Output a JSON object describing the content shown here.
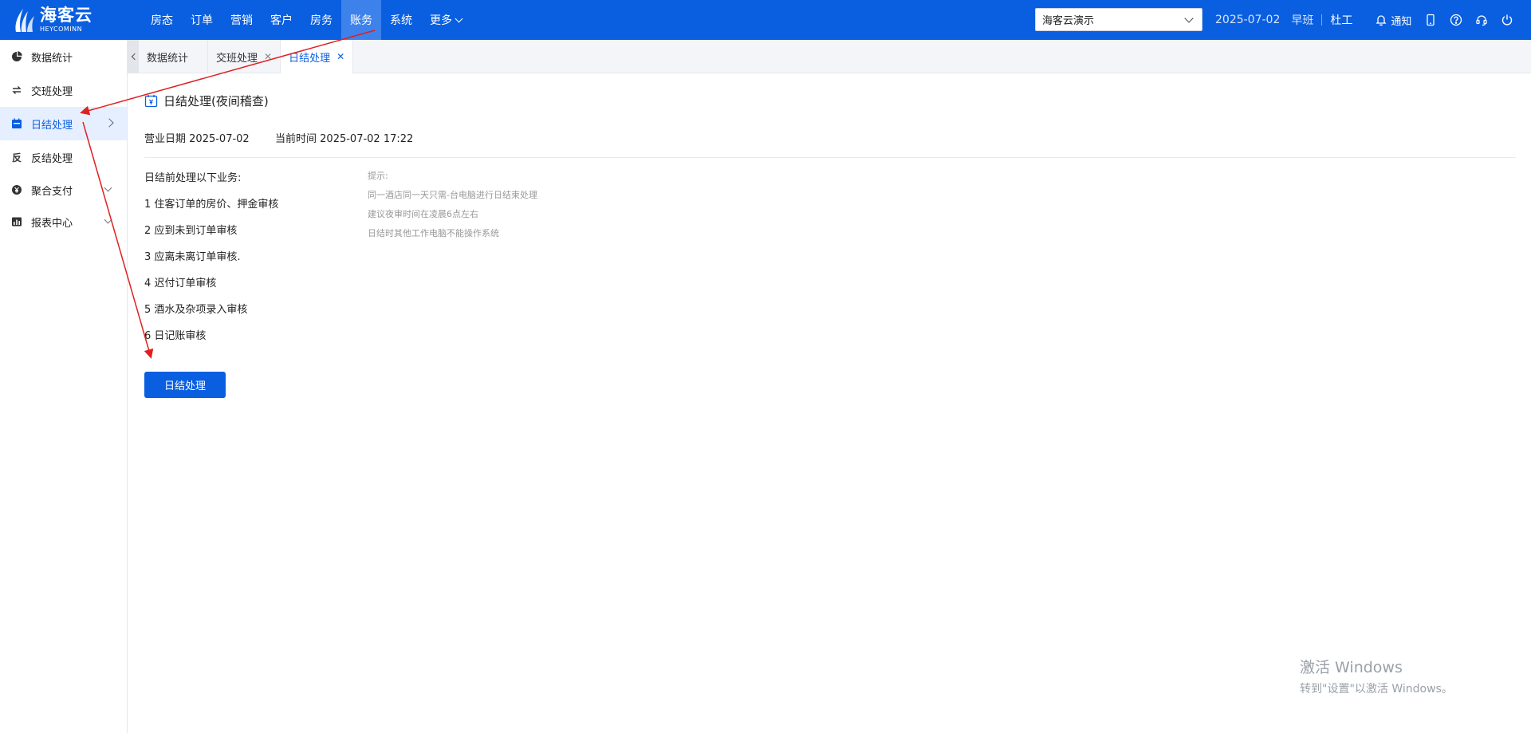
{
  "brand": {
    "name_cn": "海客云",
    "name_en": "HEYCOMINN"
  },
  "nav": {
    "items": [
      {
        "label": "房态"
      },
      {
        "label": "订单"
      },
      {
        "label": "营销"
      },
      {
        "label": "客户"
      },
      {
        "label": "房务"
      },
      {
        "label": "账务",
        "active": true
      },
      {
        "label": "系统"
      },
      {
        "label": "更多"
      }
    ]
  },
  "header": {
    "hotel": "海客云演示",
    "date": "2025-07-02",
    "shift": "早班",
    "user": "杜工",
    "notice": "通知"
  },
  "sidebar": {
    "items": [
      {
        "label": "数据统计",
        "icon": "pie-chart-icon"
      },
      {
        "label": "交班处理",
        "icon": "swap-arrows-icon"
      },
      {
        "label": "日结处理",
        "icon": "calendar-icon",
        "active": true
      },
      {
        "label": "反结处理",
        "icon": "reverse-glyph-icon",
        "glyph": "反"
      },
      {
        "label": "聚合支付",
        "icon": "yen-coin-icon"
      },
      {
        "label": "报表中心",
        "icon": "bar-chart-icon"
      }
    ]
  },
  "tabs": [
    {
      "label": "数据统计",
      "closable": false
    },
    {
      "label": "交班处理",
      "closable": true
    },
    {
      "label": "日结处理",
      "closable": true,
      "active": true
    }
  ],
  "page": {
    "title": "日结处理(夜间稽查)",
    "business_date_label": "营业日期",
    "business_date": "2025-07-02",
    "current_time_label": "当前时间",
    "current_time": "2025-07-02 17:22",
    "list_intro": "日结前处理以下业务:",
    "list": [
      "1 住客订单的房价、押金审核",
      "2 应到未到订单审核",
      "3 应离未离订单审核.",
      "4 迟付订单审核",
      "5 酒水及杂项录入审核",
      "6 日记账审核"
    ],
    "hint_title": "提示:",
    "hints": [
      "同一酒店同一天只需-台电脑进行日结束处理",
      "建议夜审时间在凌晨6点左右",
      "日结时其他工作电脑不能操作系统"
    ],
    "button": "日结处理"
  },
  "watermark": {
    "title": "激活 Windows",
    "subtitle": "转到\"设置\"以激活 Windows。"
  },
  "colors": {
    "brand_blue": "#0a5fe0",
    "annotation_red": "#e02020"
  }
}
